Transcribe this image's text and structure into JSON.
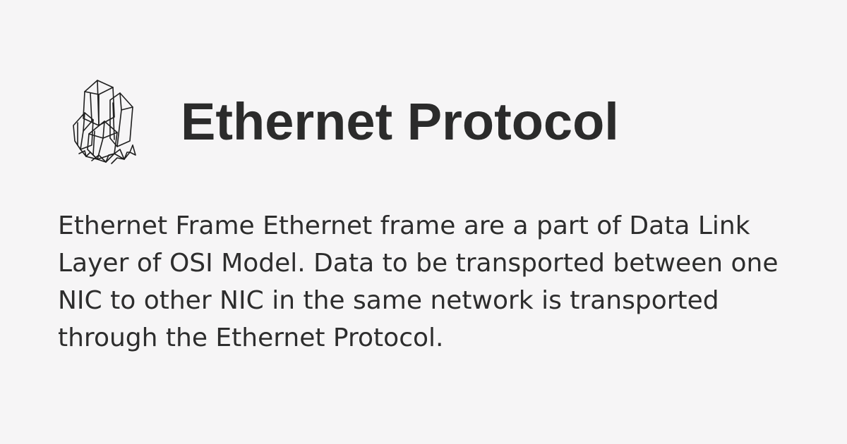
{
  "logo": {
    "icon": "crystal-cluster-icon"
  },
  "title": "Ethernet Protocol",
  "description": "Ethernet Frame Ethernet frame are a part of Data Link Layer of OSI Model. Data to be transported between one NIC to other NIC in the same network is transported through the Ethernet Protocol.",
  "colors": {
    "background": "#f6f5f6",
    "text": "#2b2b2b"
  }
}
